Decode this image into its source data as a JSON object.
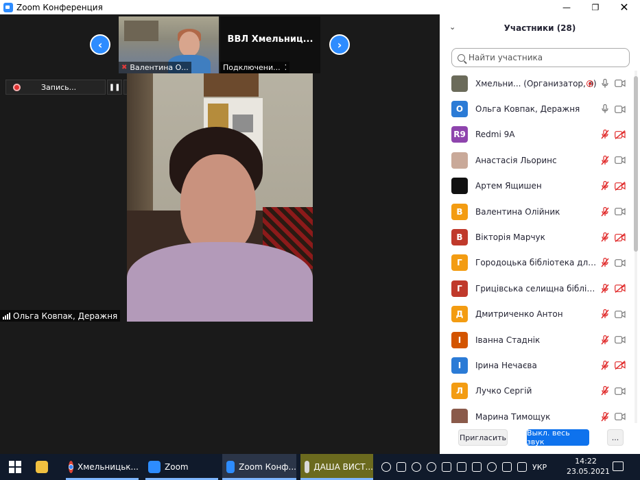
{
  "window": {
    "title": "Zoom Конференция",
    "controls": [
      "minimize",
      "restore",
      "close"
    ]
  },
  "thumbnails": [
    {
      "name": "Валентина О...",
      "muted": true
    },
    {
      "name": "ВВЛ  Хмельниц...",
      "status": "Подключени..."
    }
  ],
  "recording": {
    "label": "Запись...",
    "pause": "❚❚",
    "stop": "■"
  },
  "active_speaker": {
    "name": "Ольга Ковпак, Деражня"
  },
  "participants_panel": {
    "title": "Участники (28)",
    "search_placeholder": "Найти участника",
    "participants": [
      {
        "name": "Хмельни...  (Организатор, я)",
        "avatar_text": "",
        "avatar_color": "#6b6b5a",
        "mic": "on",
        "cam": "on",
        "extra": "record"
      },
      {
        "name": "Ольга Ковпак, Деражня",
        "avatar_text": "О",
        "avatar_color": "#2b7bd6",
        "mic": "on",
        "cam": "on"
      },
      {
        "name": "Redmi 9A",
        "avatar_text": "R9",
        "avatar_color": "#8e44ad",
        "mic": "off",
        "cam": "off"
      },
      {
        "name": "Анастасія Льоринс",
        "avatar_text": "",
        "avatar_color": "#c9a999",
        "mic": "off",
        "cam": "on"
      },
      {
        "name": "Артем Ящишен",
        "avatar_text": "",
        "avatar_color": "#111111",
        "mic": "off",
        "cam": "off"
      },
      {
        "name": "Валентина Олійник",
        "avatar_text": "В",
        "avatar_color": "#f39c12",
        "mic": "off",
        "cam": "on"
      },
      {
        "name": "Вікторія Марчук",
        "avatar_text": "В",
        "avatar_color": "#c0392b",
        "mic": "off",
        "cam": "off"
      },
      {
        "name": "Городоцька бібліотека для діт...",
        "avatar_text": "Г",
        "avatar_color": "#f39c12",
        "mic": "off",
        "cam": "on"
      },
      {
        "name": "Грицівська селищна бібліотека",
        "avatar_text": "Г",
        "avatar_color": "#c0392b",
        "mic": "off",
        "cam": "off"
      },
      {
        "name": "Дмитриченко Антон",
        "avatar_text": "Д",
        "avatar_color": "#f39c12",
        "mic": "off",
        "cam": "on"
      },
      {
        "name": "Іванна Стаднік",
        "avatar_text": "І",
        "avatar_color": "#d35400",
        "mic": "off",
        "cam": "on"
      },
      {
        "name": "Ірина Нечаєва",
        "avatar_text": "І",
        "avatar_color": "#2b7bd6",
        "mic": "off",
        "cam": "off"
      },
      {
        "name": "Лучко Сергій",
        "avatar_text": "Л",
        "avatar_color": "#f39c12",
        "mic": "off",
        "cam": "on"
      },
      {
        "name": "Марина Тимощук",
        "avatar_text": "",
        "avatar_color": "#8a5a4a",
        "mic": "off",
        "cam": "on"
      }
    ],
    "buttons": {
      "invite": "Пригласить",
      "mute_all": "Выкл. весь звук",
      "more": "..."
    }
  },
  "taskbar": {
    "items": [
      {
        "label": "",
        "icon": "folder-icon"
      },
      {
        "label": "Хмельницьк...",
        "icon": "chrome-icon"
      },
      {
        "label": "Zoom",
        "icon": "zoom-icon"
      },
      {
        "label": "Zoom Конф...",
        "icon": "zoom-icon"
      },
      {
        "label": "ДАША ВИСТ...",
        "icon": "app-icon"
      }
    ],
    "lang": "УКР",
    "time": "14:22",
    "date": "23.05.2021"
  }
}
